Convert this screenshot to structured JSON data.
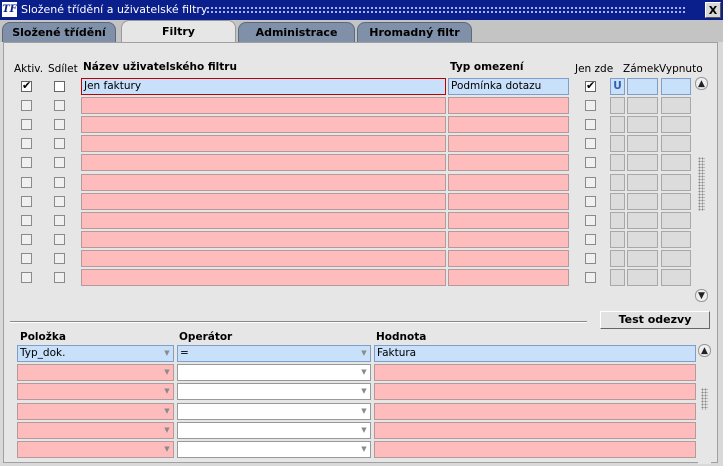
{
  "window": {
    "title": "Složené třídění a uživatelské filtry",
    "close_label": "X",
    "app_icon": "TF"
  },
  "tabs": [
    {
      "label": "Složené třídění",
      "active": false
    },
    {
      "label": "Filtry",
      "active": true
    },
    {
      "label": "Administrace filtrů",
      "active": false
    },
    {
      "label": "Hromadný filtr",
      "active": false
    }
  ],
  "filters": {
    "headers": {
      "active": "Aktiv.",
      "share": "Sdílet",
      "name": "Název uživatelského filtru",
      "type": "Typ omezení",
      "only_here": "Jen zde",
      "lock": "Zámek",
      "disabled": "Vypnuto"
    },
    "rows": [
      {
        "active": true,
        "share": false,
        "name": "Jen faktury",
        "type": "Podmínka dotazu",
        "only_here": true,
        "lock": "U",
        "disabled": ""
      },
      {
        "active": false,
        "share": false,
        "name": "",
        "type": "",
        "only_here": false,
        "lock": "",
        "disabled": ""
      },
      {
        "active": false,
        "share": false,
        "name": "",
        "type": "",
        "only_here": false,
        "lock": "",
        "disabled": ""
      },
      {
        "active": false,
        "share": false,
        "name": "",
        "type": "",
        "only_here": false,
        "lock": "",
        "disabled": ""
      },
      {
        "active": false,
        "share": false,
        "name": "",
        "type": "",
        "only_here": false,
        "lock": "",
        "disabled": ""
      },
      {
        "active": false,
        "share": false,
        "name": "",
        "type": "",
        "only_here": false,
        "lock": "",
        "disabled": ""
      },
      {
        "active": false,
        "share": false,
        "name": "",
        "type": "",
        "only_here": false,
        "lock": "",
        "disabled": ""
      },
      {
        "active": false,
        "share": false,
        "name": "",
        "type": "",
        "only_here": false,
        "lock": "",
        "disabled": ""
      },
      {
        "active": false,
        "share": false,
        "name": "",
        "type": "",
        "only_here": false,
        "lock": "",
        "disabled": ""
      },
      {
        "active": false,
        "share": false,
        "name": "",
        "type": "",
        "only_here": false,
        "lock": "",
        "disabled": ""
      },
      {
        "active": false,
        "share": false,
        "name": "",
        "type": "",
        "only_here": false,
        "lock": "",
        "disabled": ""
      }
    ]
  },
  "test_button_label": "Test odezvy",
  "conditions": {
    "headers": {
      "item": "Položka",
      "operator": "Operátor",
      "value": "Hodnota"
    },
    "rows": [
      {
        "item": "Typ_dok.",
        "operator": "=",
        "value": "Faktura"
      },
      {
        "item": "",
        "operator": "",
        "value": ""
      },
      {
        "item": "",
        "operator": "",
        "value": ""
      },
      {
        "item": "",
        "operator": "",
        "value": ""
      },
      {
        "item": "",
        "operator": "",
        "value": ""
      },
      {
        "item": "",
        "operator": "",
        "value": ""
      }
    ]
  },
  "icons": {
    "check": "✔",
    "scroll_up": "▲",
    "scroll_down": "▼",
    "dropdown": "▼"
  },
  "colors": {
    "title_bar": "#0a1e8c",
    "required_field": "#ffbcbc",
    "current_record": "#c8e0fa",
    "tab_inactive": "#7f90a8"
  }
}
